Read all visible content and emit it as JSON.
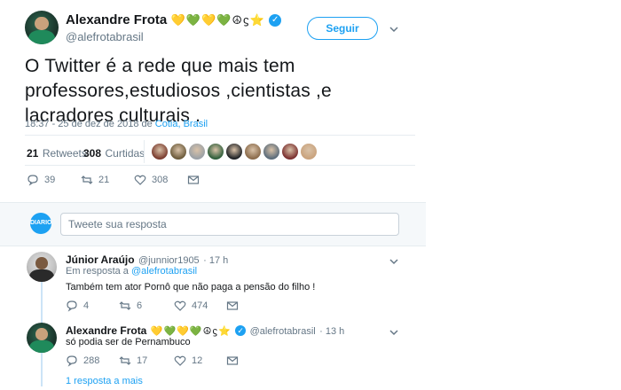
{
  "author": {
    "name": "Alexandre Frota",
    "emoji": "💛💚💛💚☮ϛ⭐",
    "handle": "@alefrotabrasil",
    "follow_label": "Seguir"
  },
  "tweet": {
    "text_line1": "O Twitter é a rede que mais tem",
    "text_line2": "professores,estudiosos ,cientistas ,e",
    "text_line3": "lacradores culturais .",
    "timestamp": "18:37 - 25 de dez de 2018 de",
    "location": "Cotia, Brasil"
  },
  "stats": {
    "retweets_count": "21",
    "retweets_label": "Retweets",
    "likes_count": "308",
    "likes_label": "Curtidas",
    "liker_avatar_colors": [
      "#7a3b2e",
      "#6b5a3a",
      "#9aa0a6",
      "#2e5e3a",
      "#1d2024",
      "#8a6a4a",
      "#5a6b7a",
      "#7a2e2e",
      "#c9a27c"
    ]
  },
  "actions": {
    "replies": "39",
    "retweets": "21",
    "likes": "308"
  },
  "compose": {
    "avatar_label": "DIARIO",
    "placeholder": "Tweete sua resposta"
  },
  "replies": [
    {
      "name": "Júnior Araújo",
      "handle": "@junnior1905",
      "time": "· 17 h",
      "in_reply_prefix": "Em resposta a",
      "in_reply_to": "@alefrotabrasil",
      "text": "Também tem ator Pornô que não paga a pensão do filho !",
      "replies": "4",
      "retweets": "6",
      "likes": "474"
    },
    {
      "name": "Alexandre Frota",
      "emoji": "💛💚💛💚☮ϛ⭐",
      "handle": "@alefrotabrasil",
      "time": "· 13 h",
      "text": "só podia ser de Pernambuco",
      "replies": "288",
      "retweets": "17",
      "likes": "12"
    }
  ],
  "more_replies_label": "1 resposta a mais",
  "icons": {
    "reply": "reply-icon",
    "retweet": "retweet-icon",
    "like": "heart-icon",
    "dm": "envelope-icon",
    "more": "chevron-down-icon",
    "verified": "verified-badge-icon"
  },
  "colors": {
    "accent": "#1da1f2",
    "muted": "#657786",
    "divider": "#e6ecf0"
  }
}
